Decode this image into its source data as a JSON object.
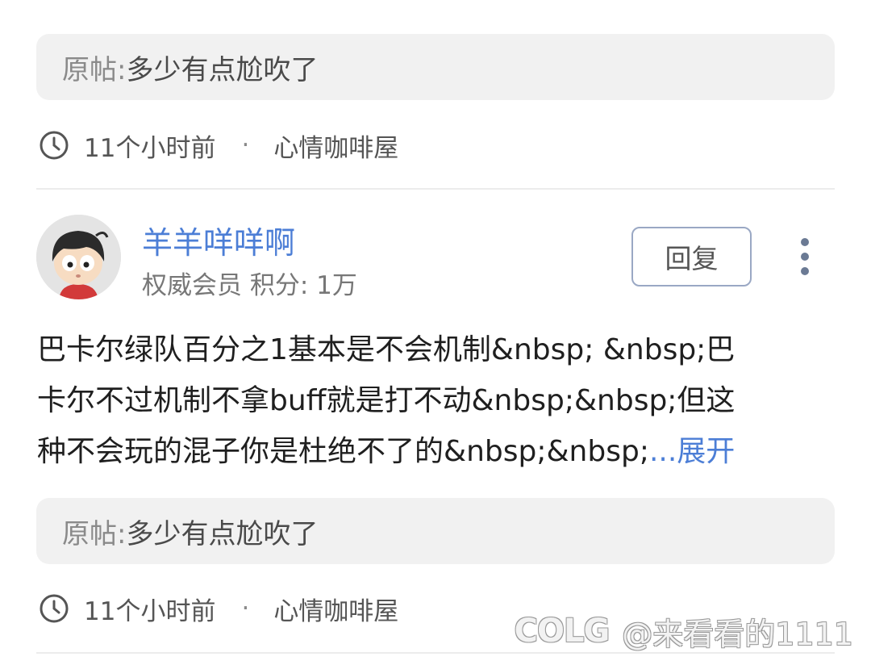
{
  "previous_comment": {
    "cut_text": "...........",
    "quote": {
      "prefix": "原帖: ",
      "text": "多少有点尬吹了"
    },
    "meta": {
      "time": "11个小时前",
      "separator": "·",
      "forum": "心情咖啡屋"
    }
  },
  "comment": {
    "username": "羊羊咩咩啊",
    "rank": "权威会员 积分: 1万",
    "reply_label": "回复",
    "body_lines": [
      "巴卡尔绿队百分之1基本是不会机制&nbsp; &nbsp;巴",
      "卡尔不过机制不拿buff就是打不动&nbsp;&nbsp;但这",
      "种不会玩的混子你是杜绝不了的&nbsp;&nbsp;"
    ],
    "expand_label": "...展开",
    "quote": {
      "prefix": "原帖: ",
      "text": "多少有点尬吹了"
    },
    "meta": {
      "time": "11个小时前",
      "separator": "·",
      "forum": "心情咖啡屋"
    }
  },
  "watermark": {
    "logo": "COLG",
    "text": "@来看看的1111"
  },
  "colors": {
    "accent": "#4c7ed6",
    "quote_bg": "#f1f1f1",
    "muted": "#8a8a8a"
  }
}
